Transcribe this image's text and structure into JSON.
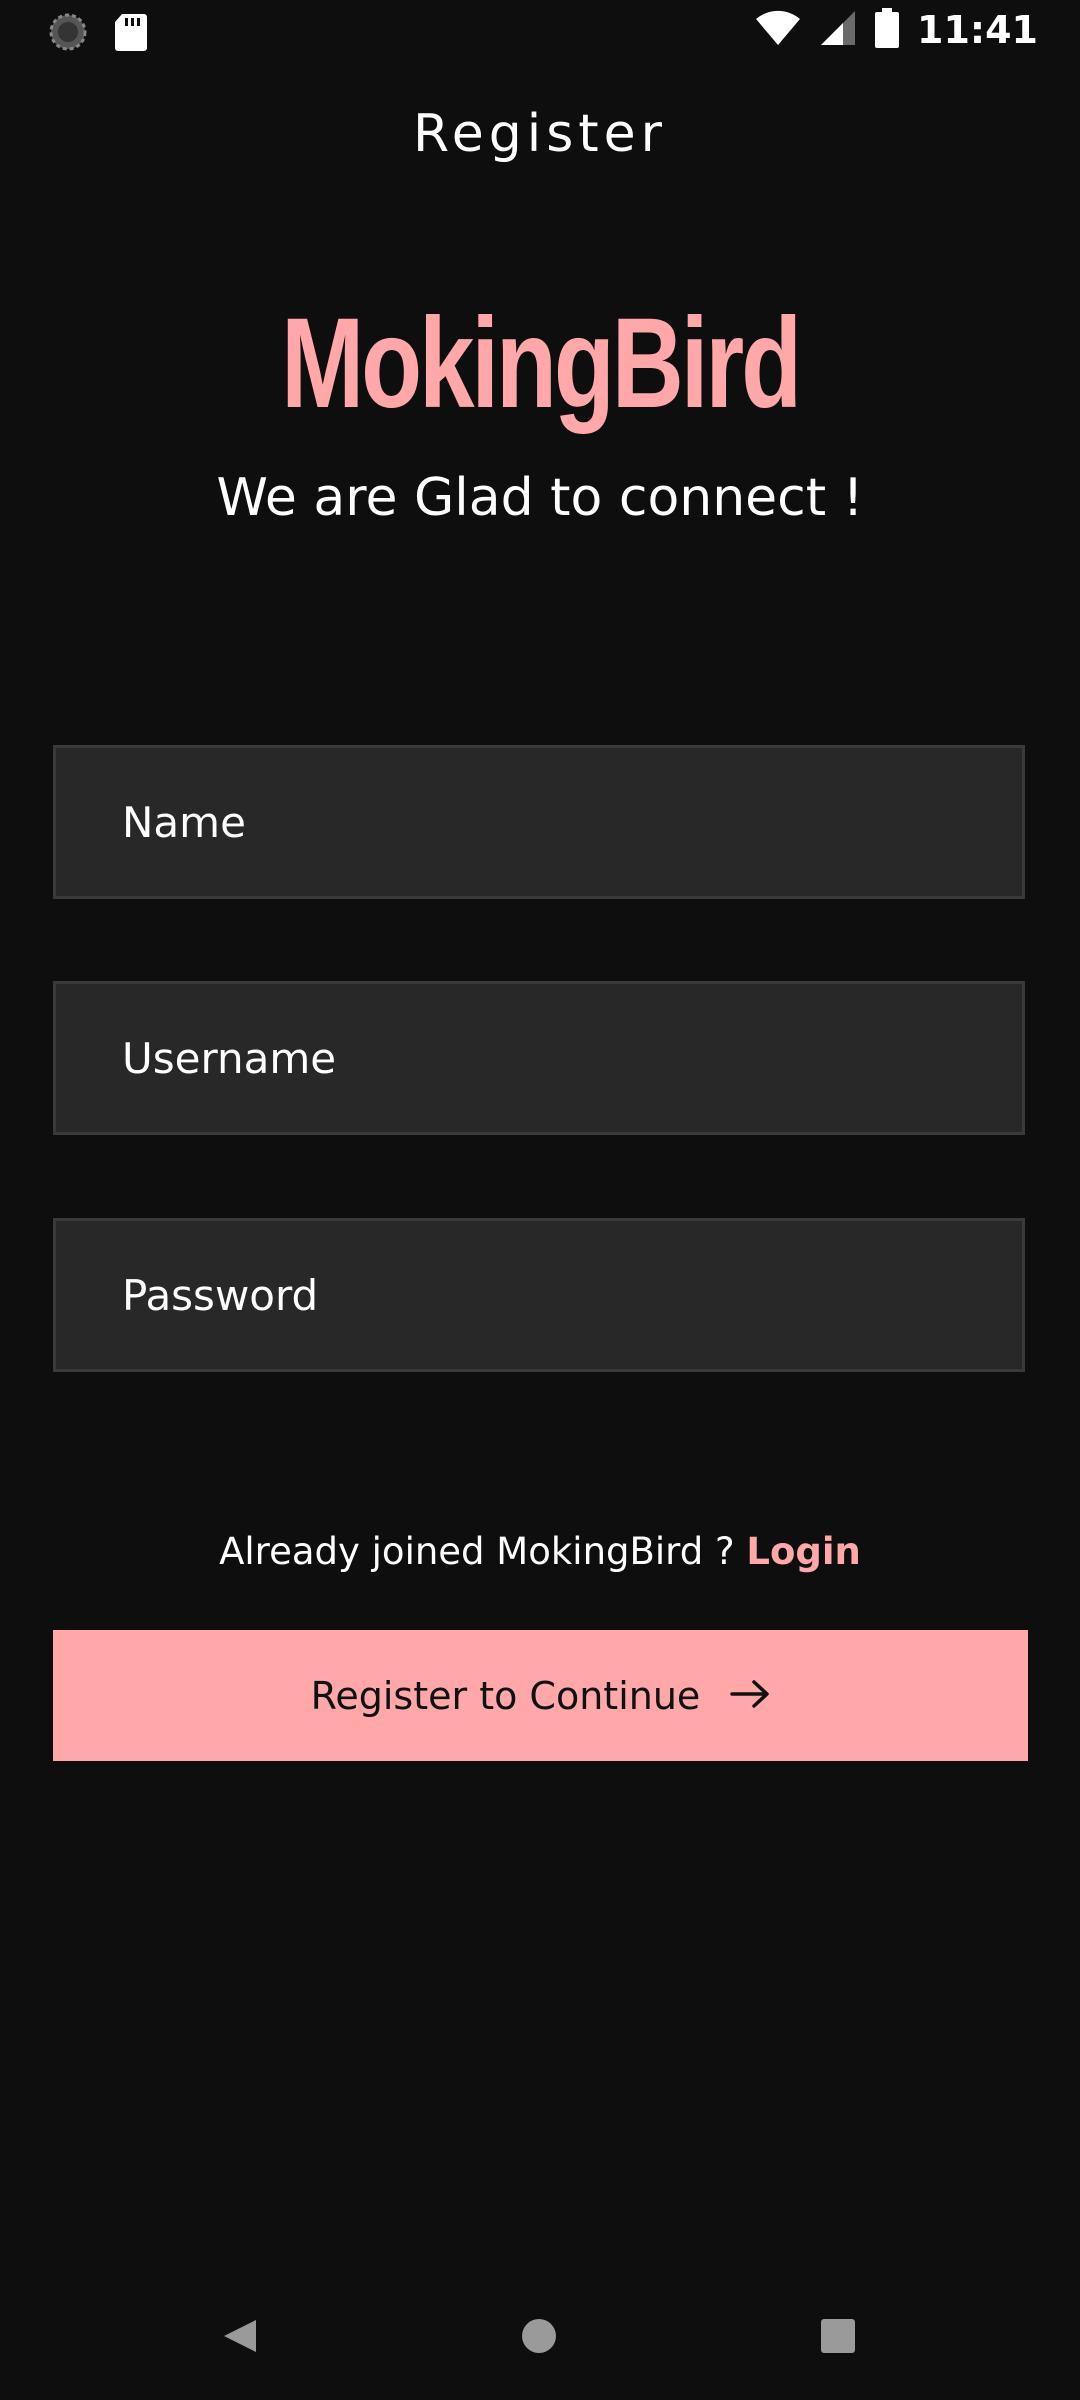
{
  "status_bar": {
    "time": "11:41",
    "icons": [
      "loading-icon",
      "sd-card-icon",
      "wifi-icon",
      "signal-icon",
      "battery-icon"
    ]
  },
  "header": {
    "title": "Register"
  },
  "brand": {
    "logo_text": "MokingBird",
    "tagline": "We are Glad to connect !",
    "accent_color": "#ffa7a9"
  },
  "form": {
    "name_placeholder": "Name",
    "username_placeholder": "Username",
    "password_placeholder": "Password"
  },
  "login_prompt": {
    "text": "Already joined MokingBird ? ",
    "link_label": "Login"
  },
  "register_button": {
    "label": "Register to Continue",
    "icon": "arrow-right-icon"
  },
  "nav_bar": {
    "icons": [
      "back-icon",
      "home-icon",
      "recent-apps-icon"
    ]
  }
}
